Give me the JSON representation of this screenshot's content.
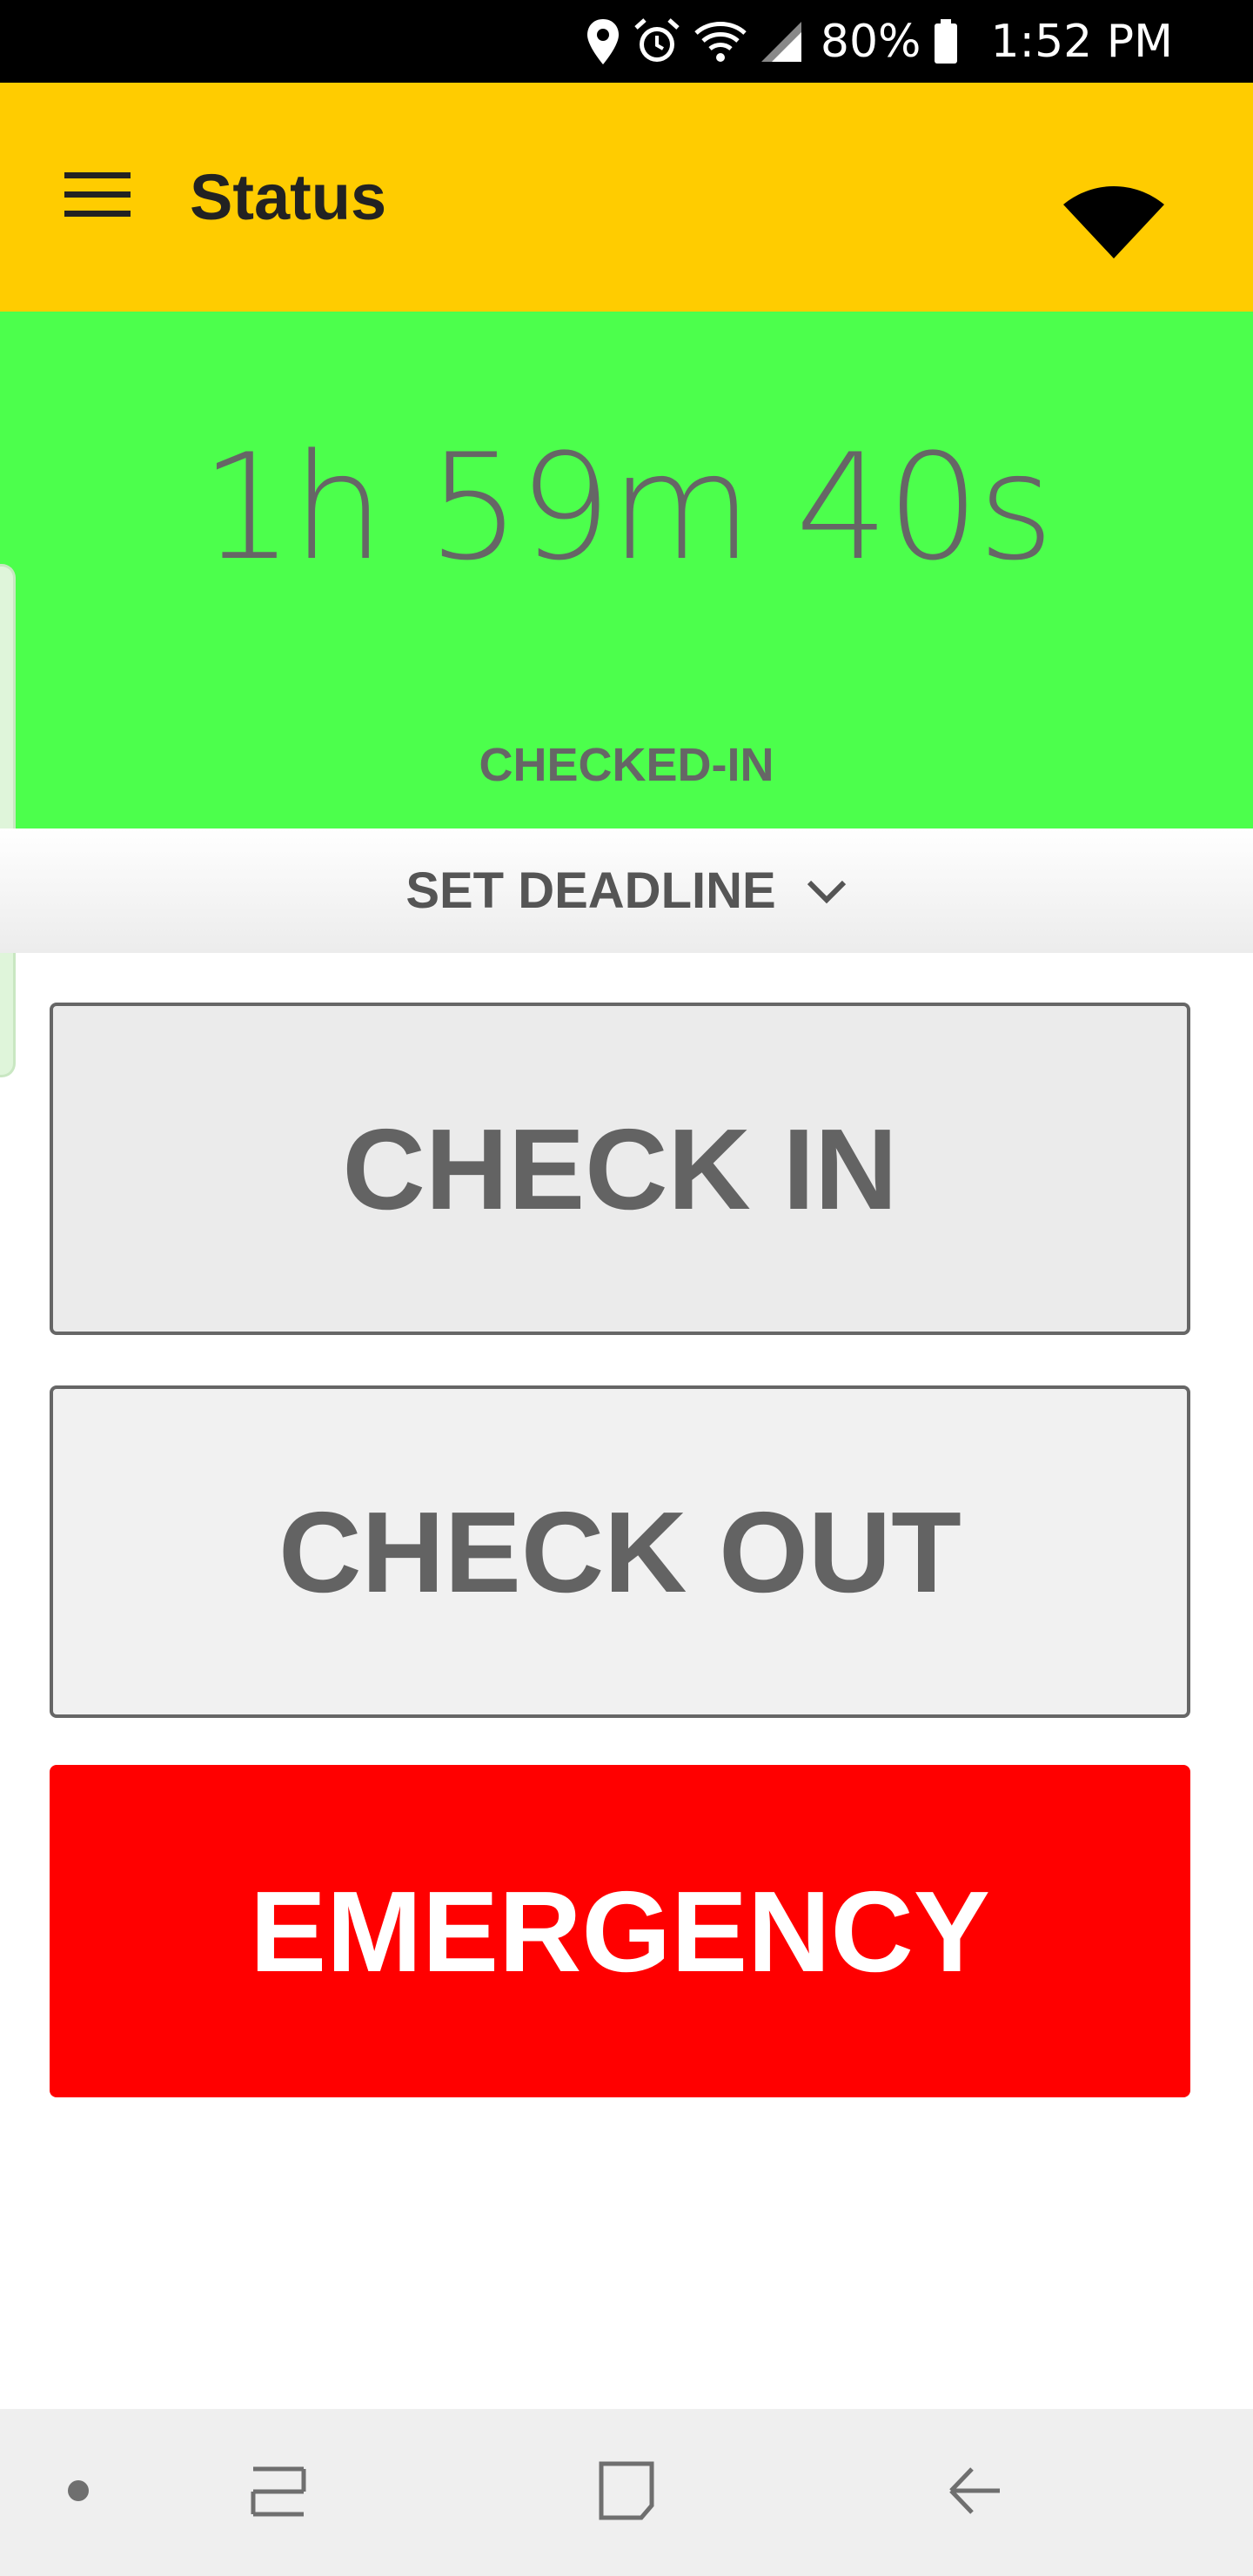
{
  "status_bar": {
    "battery_percent": "80%",
    "time": "1:52 PM",
    "icons": [
      "location-icon",
      "alarm-icon",
      "wifi-icon",
      "signal-icon",
      "battery-icon"
    ]
  },
  "app_bar": {
    "title": "Status",
    "icons": [
      "menu-icon",
      "connection-icon"
    ],
    "background_color": "#ffcc00"
  },
  "status_panel": {
    "timer": "1h 59m 40s",
    "status": "CHECKED-IN",
    "background_color": "#4cff4c"
  },
  "deadline": {
    "label": "SET DEADLINE",
    "icon": "chevron-down-icon"
  },
  "actions": {
    "check_in": "CHECK IN",
    "check_out": "CHECK OUT",
    "emergency": "EMERGENCY",
    "emergency_color": "#ff0000"
  },
  "nav_bar": {
    "icons": [
      "dot-icon",
      "recent-apps-icon",
      "home-icon",
      "back-icon"
    ]
  }
}
